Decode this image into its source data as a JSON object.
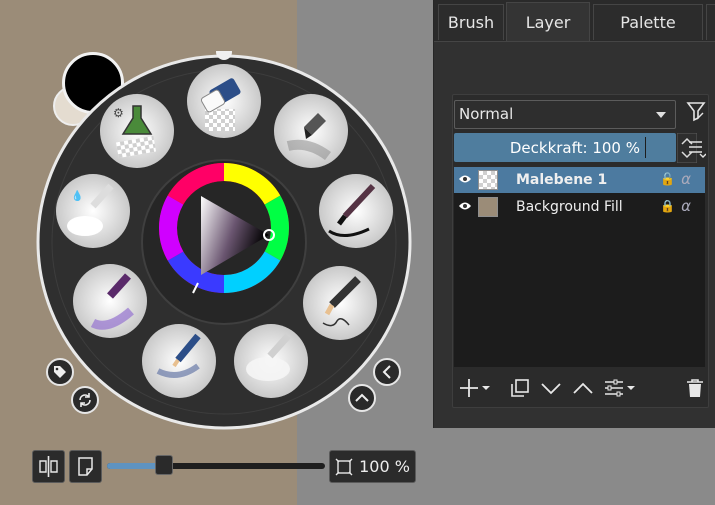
{
  "tabs": [
    {
      "label": "Brush"
    },
    {
      "label": "Layer"
    },
    {
      "label": "Palette"
    }
  ],
  "layers_panel": {
    "blend_mode": "Normal",
    "opacity": "Deckkraft:  100 %",
    "layers": [
      {
        "name": "Malebene 1",
        "selected": true
      },
      {
        "name": "Background Fill",
        "selected": false
      }
    ]
  },
  "canvas": {
    "left_color": "#9b8c78",
    "right_color": "#8a8a8a",
    "foreground_color": "#000000",
    "background_color": "#e4dcd0"
  },
  "popup_palette": {
    "brush_presets": [
      "eraser-brush-icon",
      "inking-pen-brush-icon",
      "ink-brush-icon",
      "pencil-brush-icon",
      "chalk-brush-icon",
      "color-pencil-brush-icon",
      "purple-marker-brush-icon",
      "airbrush-soft-icon",
      "experimental-chemistry-brush-icon"
    ],
    "selected_hue": "#ff2a6a"
  },
  "bottom_bar": {
    "zoom": "100 %",
    "slider_fraction": 0.26
  },
  "colors": {
    "accent": "#4f7d9e",
    "selection": "#4c7aa0",
    "panel_bg": "#313131"
  }
}
